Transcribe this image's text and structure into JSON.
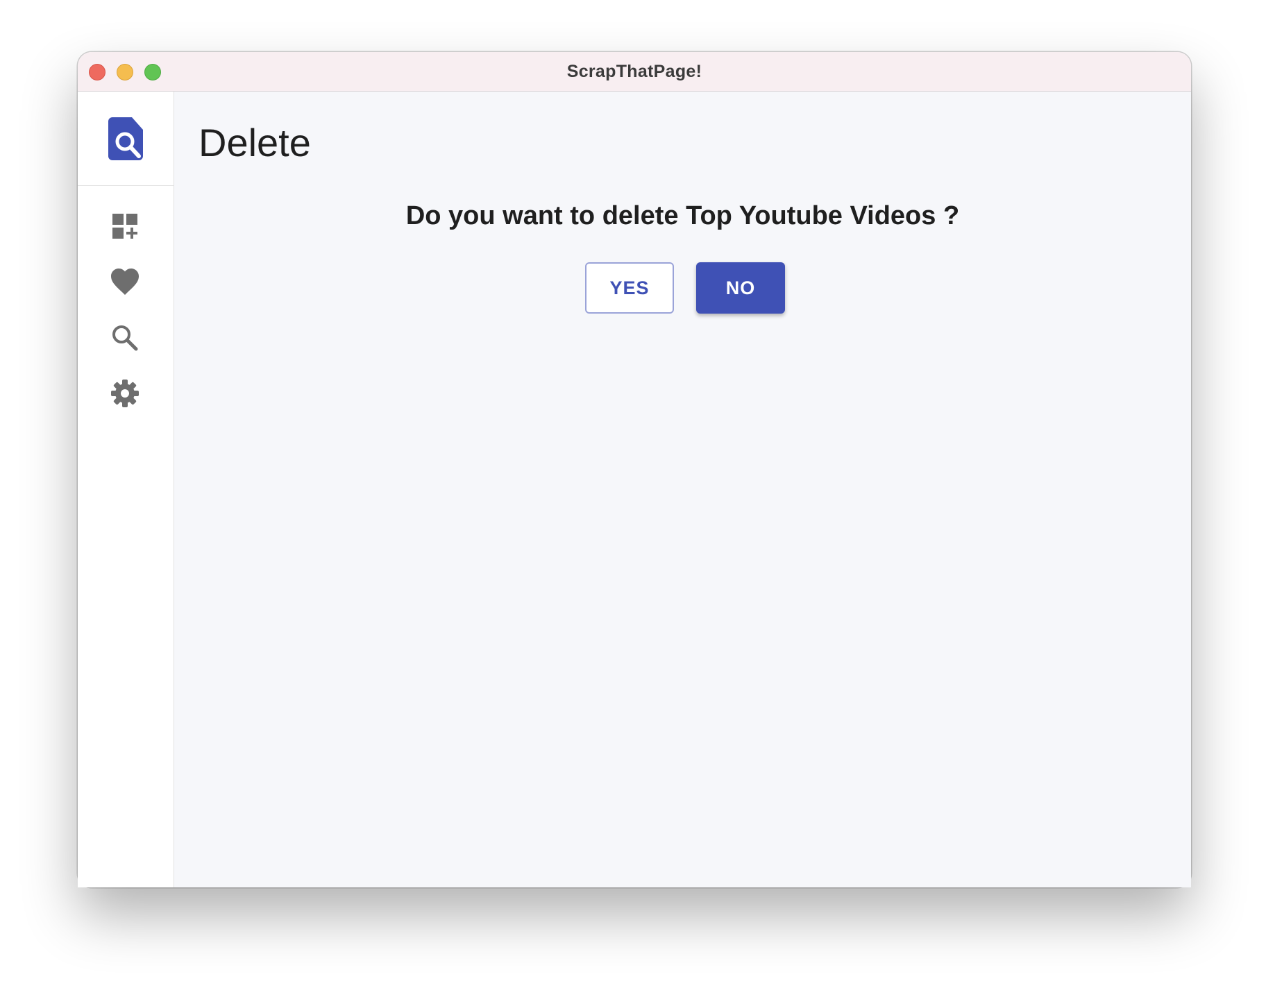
{
  "window": {
    "title": "ScrapThatPage!"
  },
  "sidebar": {
    "logo": "search-document-icon",
    "items": [
      {
        "icon": "dashboard-add-icon"
      },
      {
        "icon": "heart-icon"
      },
      {
        "icon": "search-icon"
      },
      {
        "icon": "gear-icon"
      }
    ]
  },
  "main": {
    "title": "Delete",
    "prompt": "Do you want to delete Top Youtube Videos ?",
    "yes_label": "YES",
    "no_label": "NO"
  },
  "colors": {
    "accent": "#3f51b5",
    "icon_gray": "#6e6e6e",
    "background": "#f6f7fa",
    "titlebar": "#f8eef1"
  }
}
